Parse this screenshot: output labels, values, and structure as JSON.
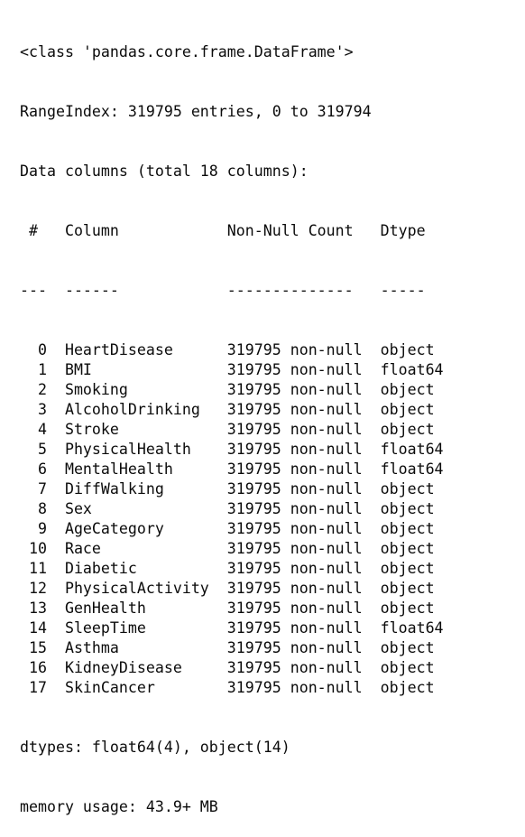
{
  "output": {
    "kind": "pandas-dataframe-info",
    "background_color": "#ffffff",
    "text_color": "#0b0b0b",
    "header": {
      "class_line": "<class 'pandas.core.frame.DataFrame'>",
      "range_index_line": "RangeIndex: 319795 entries, 0 to 319794",
      "data_columns_line": "Data columns (total 18 columns):",
      "column_headers_line": " #   Column            Non-Null Count   Dtype  ",
      "separator_line": "---  ------            --------------   -----  "
    },
    "table": {
      "headers": [
        "#",
        "Column",
        "Non-Null Count",
        "Dtype"
      ],
      "separators": [
        "---",
        "------",
        "--------------",
        "-----"
      ],
      "rows": [
        {
          "index": "0",
          "column": "HeartDisease",
          "non_null_count": "319795 non-null",
          "dtype": "object"
        },
        {
          "index": "1",
          "column": "BMI",
          "non_null_count": "319795 non-null",
          "dtype": "float64"
        },
        {
          "index": "2",
          "column": "Smoking",
          "non_null_count": "319795 non-null",
          "dtype": "object"
        },
        {
          "index": "3",
          "column": "AlcoholDrinking",
          "non_null_count": "319795 non-null",
          "dtype": "object"
        },
        {
          "index": "4",
          "column": "Stroke",
          "non_null_count": "319795 non-null",
          "dtype": "object"
        },
        {
          "index": "5",
          "column": "PhysicalHealth",
          "non_null_count": "319795 non-null",
          "dtype": "float64"
        },
        {
          "index": "6",
          "column": "MentalHealth",
          "non_null_count": "319795 non-null",
          "dtype": "float64"
        },
        {
          "index": "7",
          "column": "DiffWalking",
          "non_null_count": "319795 non-null",
          "dtype": "object"
        },
        {
          "index": "8",
          "column": "Sex",
          "non_null_count": "319795 non-null",
          "dtype": "object"
        },
        {
          "index": "9",
          "column": "AgeCategory",
          "non_null_count": "319795 non-null",
          "dtype": "object"
        },
        {
          "index": "10",
          "column": "Race",
          "non_null_count": "319795 non-null",
          "dtype": "object"
        },
        {
          "index": "11",
          "column": "Diabetic",
          "non_null_count": "319795 non-null",
          "dtype": "object"
        },
        {
          "index": "12",
          "column": "PhysicalActivity",
          "non_null_count": "319795 non-null",
          "dtype": "object"
        },
        {
          "index": "13",
          "column": "GenHealth",
          "non_null_count": "319795 non-null",
          "dtype": "object"
        },
        {
          "index": "14",
          "column": "SleepTime",
          "non_null_count": "319795 non-null",
          "dtype": "float64"
        },
        {
          "index": "15",
          "column": "Asthma",
          "non_null_count": "319795 non-null",
          "dtype": "object"
        },
        {
          "index": "16",
          "column": "KidneyDisease",
          "non_null_count": "319795 non-null",
          "dtype": "object"
        },
        {
          "index": "17",
          "column": "SkinCancer",
          "non_null_count": "319795 non-null",
          "dtype": "object"
        }
      ]
    },
    "footer": {
      "dtypes_line": "dtypes: float64(4), object(14)",
      "memory_usage_line": "memory usage: 43.9+ MB"
    },
    "summary": {
      "total_entries": "319795",
      "index_start": "0",
      "index_end": "319794",
      "total_columns": "18",
      "float64_count": "4",
      "object_count": "14",
      "memory_usage": "43.9+ MB"
    }
  }
}
